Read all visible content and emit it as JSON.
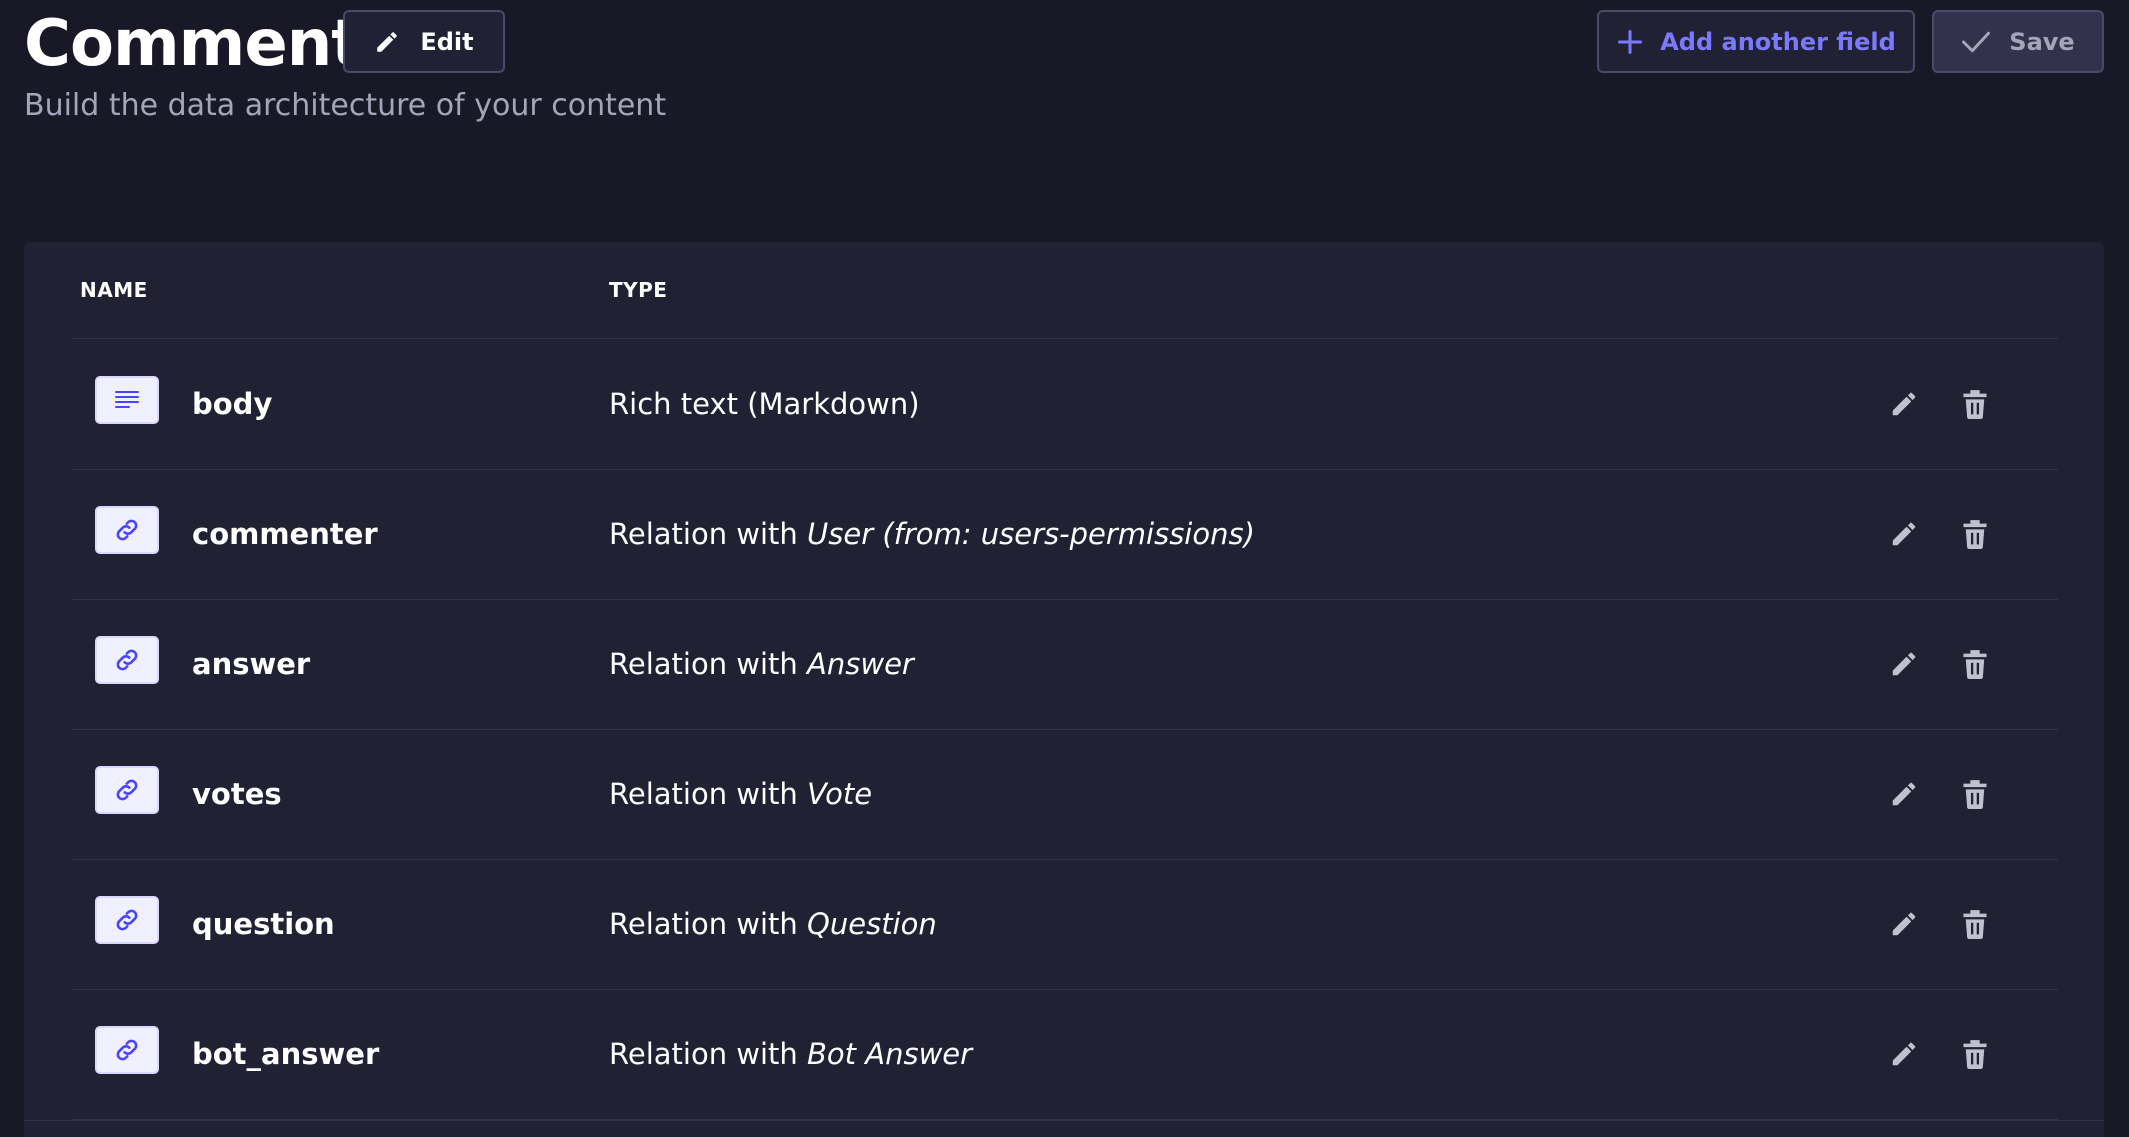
{
  "header": {
    "title": "Comment",
    "subtitle": "Build the data architecture of your content",
    "edit_label": "Edit",
    "add_label": "Add another field",
    "save_label": "Save"
  },
  "table": {
    "columns": [
      "NAME",
      "TYPE"
    ],
    "rows": [
      {
        "name": "body",
        "icon": "text-icon",
        "type_prefix": "Rich text (Markdown)",
        "type_target": ""
      },
      {
        "name": "commenter",
        "icon": "relation-icon",
        "type_prefix": "Relation with ",
        "type_target": "User (from: users-permissions)"
      },
      {
        "name": "answer",
        "icon": "relation-icon",
        "type_prefix": "Relation with ",
        "type_target": "Answer"
      },
      {
        "name": "votes",
        "icon": "relation-icon",
        "type_prefix": "Relation with ",
        "type_target": "Vote"
      },
      {
        "name": "question",
        "icon": "relation-icon",
        "type_prefix": "Relation with ",
        "type_target": "Question"
      },
      {
        "name": "bot_answer",
        "icon": "relation-icon",
        "type_prefix": "Relation with ",
        "type_target": "Bot Answer"
      }
    ]
  },
  "colors": {
    "background": "#181826",
    "card": "#212134",
    "accent": "#7b79ff",
    "muted": "#a5a5ba"
  }
}
